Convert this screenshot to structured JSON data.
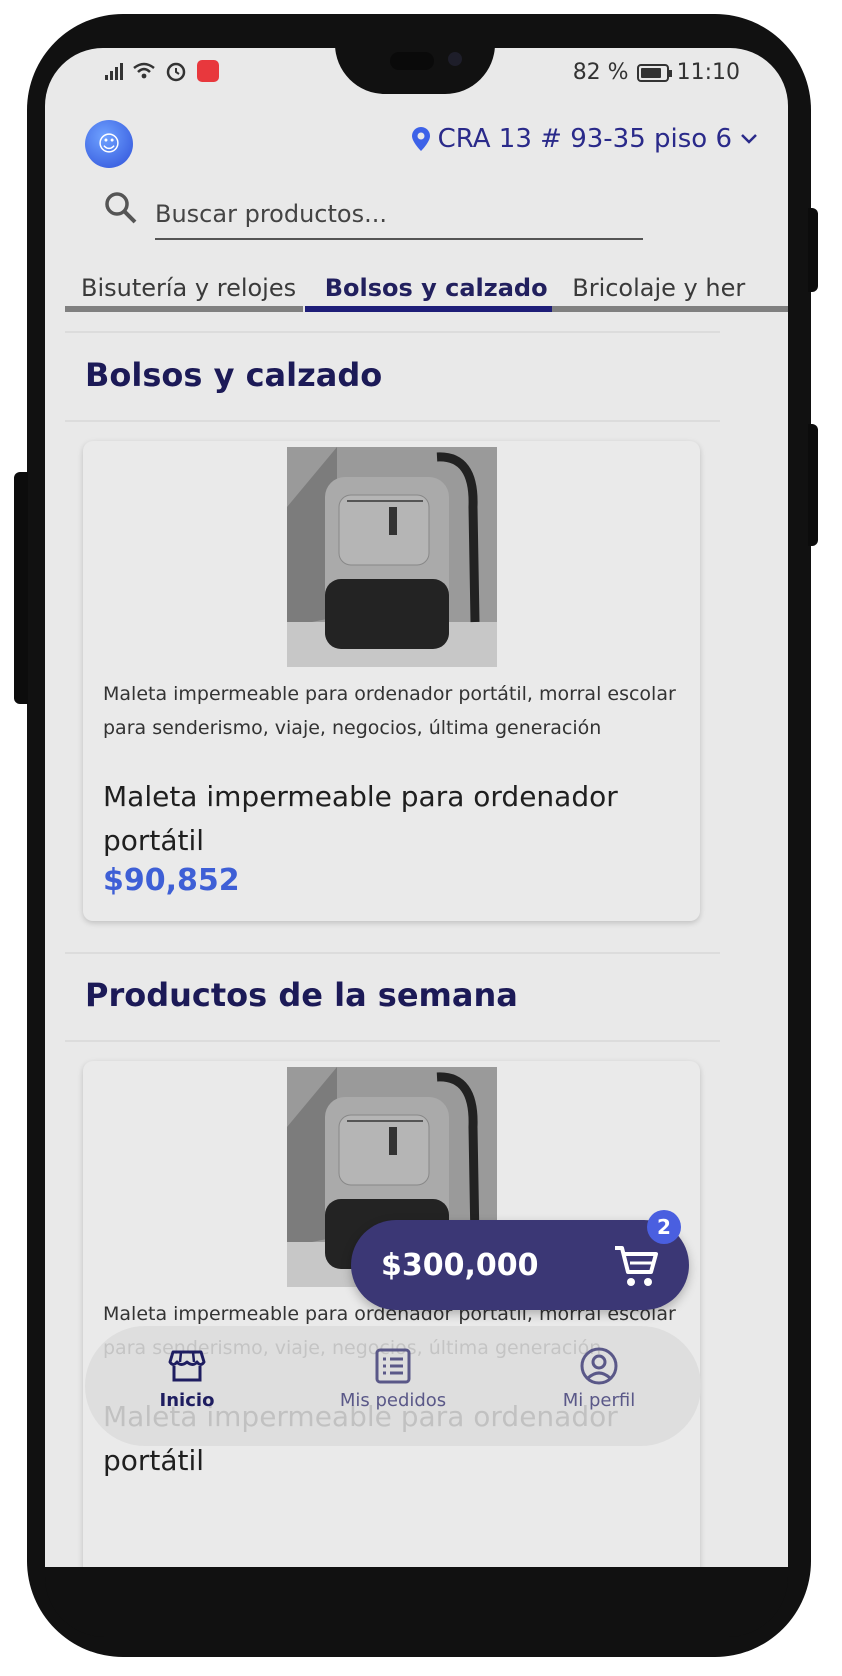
{
  "status_bar": {
    "battery": "82 %",
    "time": "11:10"
  },
  "header": {
    "address": "CRA 13 # 93-35 piso 6",
    "logo_icon": "smiley-face-icon"
  },
  "search": {
    "placeholder": "Buscar productos..."
  },
  "categories": {
    "items": [
      "Bisutería y relojes",
      "Bolsos y calzado",
      "Bricolaje y her"
    ],
    "active_index": 1
  },
  "sections": [
    {
      "title": "Bolsos y calzado",
      "product": {
        "description": "Maleta impermeable para ordenador portátil, morral escolar para senderismo, viaje, negocios, última generación",
        "name": "Maleta impermeable para ordenador portátil",
        "price": "$90,852"
      }
    },
    {
      "title": "Productos de la semana",
      "product": {
        "description": "Maleta impermeable para ordenador portátil, morral escolar para senderismo, viaje, negocios, última generación",
        "name": "Maleta impermeable para ordenador portátil",
        "price": ""
      }
    }
  ],
  "cart": {
    "total": "$300,000",
    "count": "2"
  },
  "bottom_nav": {
    "items": [
      {
        "label": "Inicio",
        "icon": "store-icon",
        "active": true
      },
      {
        "label": "Mis pedidos",
        "icon": "list-icon",
        "active": false
      },
      {
        "label": "Mi perfil",
        "icon": "user-circle-icon",
        "active": false
      }
    ]
  },
  "colors": {
    "primary": "#1e1d78",
    "price": "#3e5fd6",
    "cart_bg": "#3b3775"
  }
}
